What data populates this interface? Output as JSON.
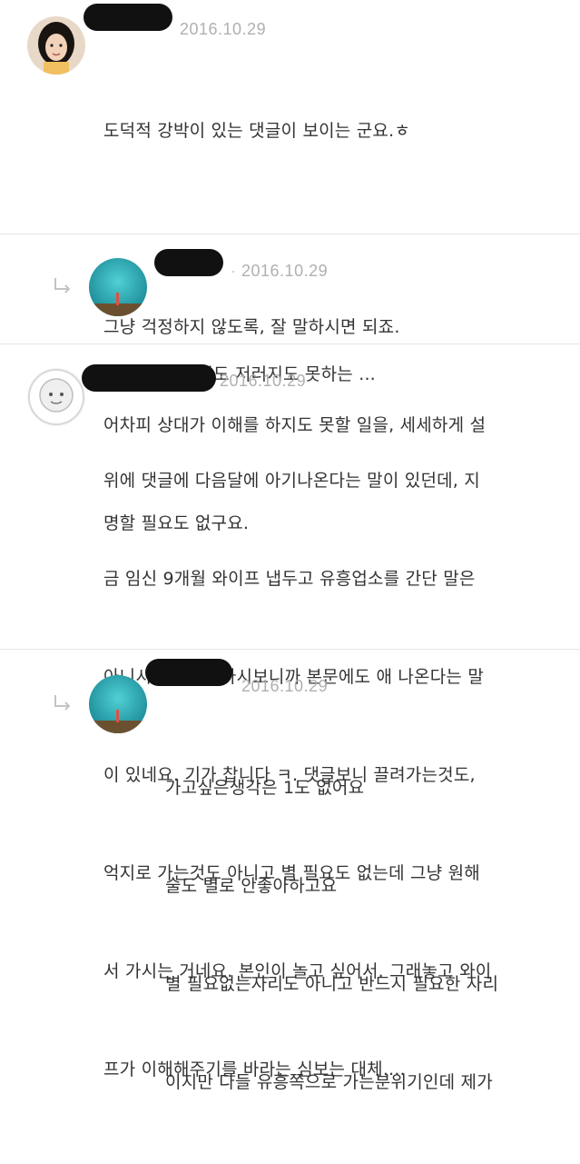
{
  "comments": [
    {
      "date": "2016.10.29",
      "lines": [
        "도덕적 강박이 있는 댓글이 보이는 군요.ㅎ",
        "",
        "그냥 걱정하지 않도록, 잘 말하시면 되죠.",
        "어차피 상대가 이해를 하지도 못할 일을, 세세하게 설",
        "명할 필요도 없구요."
      ]
    },
    {
      "date": "2016.10.29",
      "lines": [
        "이러지도 저러지도 못하는 ..."
      ]
    },
    {
      "date": "2016.10.29",
      "lines": [
        "위에 댓글에 다음달에 아기나온다는 말이 있던데, 지",
        "금 임신 9개월 와이프 냅두고 유흥업소를 간단 말은",
        "아니시죠 설마? 다시보니까 본문에도 애 나온다는 말",
        "이 있네요. 기가 찹니다 ㅋ. 댓글보니 끌려가는것도,",
        "억지로 가는것도 아니고 별 필요도 없는데 그냥 원해",
        "서 가시는 거네요. 본인이 놀고 싶어서. 그래놓고 와이",
        "프가 이해해주기를 바라는 심보는 대체...."
      ]
    },
    {
      "date": "2016.10.29",
      "lines": [
        "가고싶은생각은 1도 없어요",
        "술도 별로 안좋아하고요",
        "별 필요없는자리도 아니고 반드시 필요한 자리",
        "이지만 다들 유흥쪽으로 가는분위기인데 제가"
      ]
    }
  ],
  "colors": {
    "date": "#b0b0b0",
    "text": "#333333",
    "divider": "#e6e6e6",
    "reply_arrow": "#c4c4c4"
  }
}
